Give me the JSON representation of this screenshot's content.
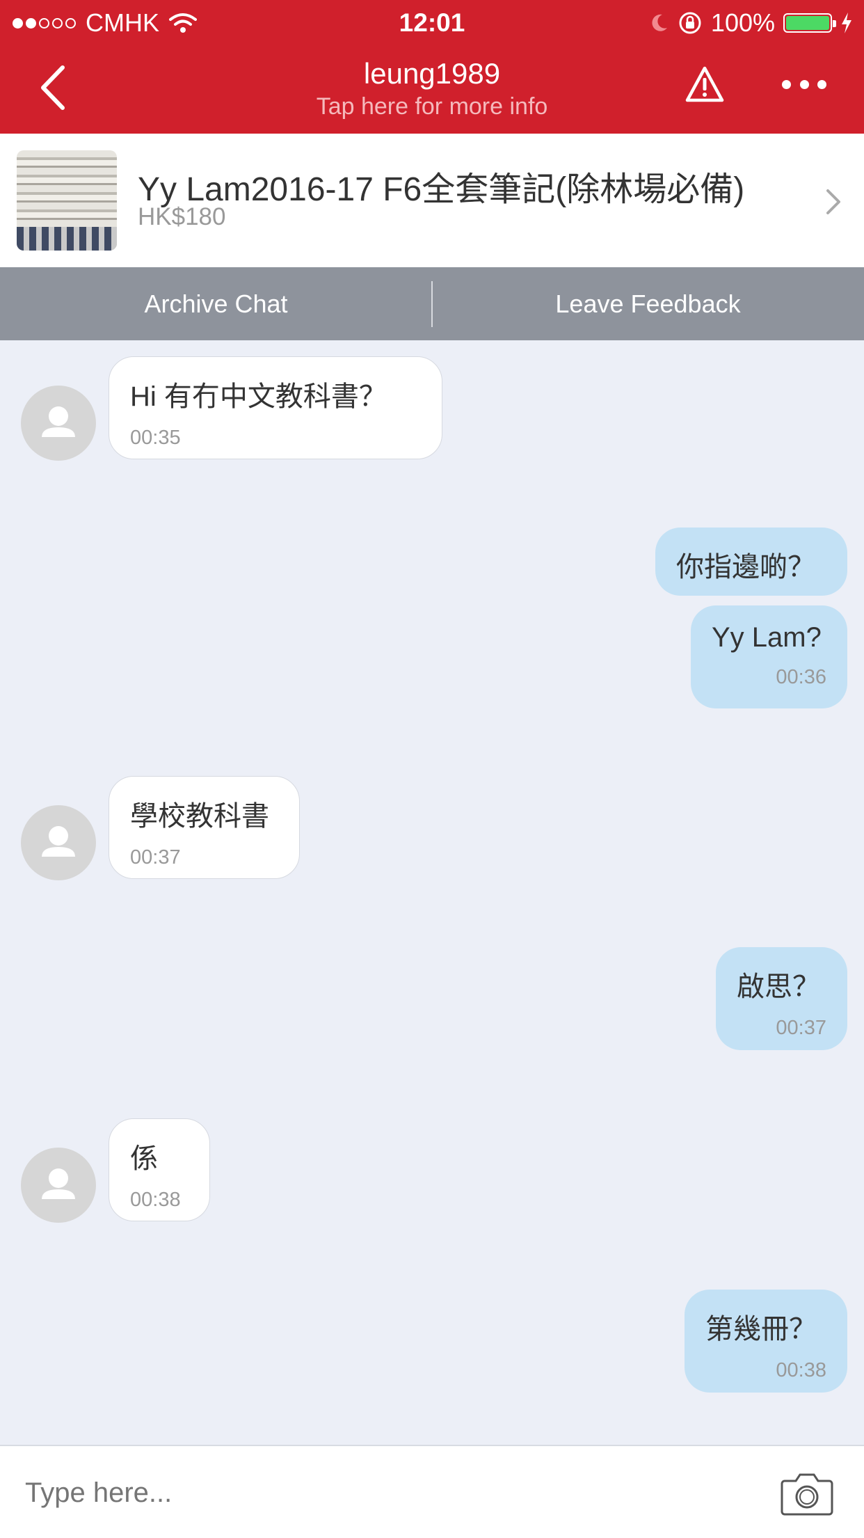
{
  "status_bar": {
    "carrier": "CMHK",
    "time": "12:01",
    "battery": "100%",
    "signal_bars_filled": 2,
    "signal_bars_total": 5,
    "battery_level": 1.0
  },
  "nav": {
    "title": "leung1989",
    "subtitle": "Tap here for more info",
    "icons": [
      "chevron-left-icon",
      "warning-icon",
      "more-icon"
    ]
  },
  "listing": {
    "title": "Yy Lam2016-17 F6全套筆記(除林場必備)",
    "price": "HK$180"
  },
  "actions": {
    "archive": "Archive Chat",
    "feedback": "Leave Feedback"
  },
  "messages": [
    {
      "side": "in",
      "text": "Hi 有冇中文教科書？",
      "time": "00:35"
    },
    {
      "side": "out",
      "text": "你指邊啲？",
      "time": ""
    },
    {
      "side": "out",
      "text": "Yy Lam?",
      "time": "00:36"
    },
    {
      "side": "in",
      "text": "學校教科書",
      "time": "00:37"
    },
    {
      "side": "out",
      "text": "啟思？",
      "time": "00:37"
    },
    {
      "side": "in",
      "text": "係",
      "time": "00:38"
    },
    {
      "side": "out",
      "text": "第幾冊？",
      "time": "00:38"
    }
  ],
  "composer": {
    "placeholder": "Type here..."
  },
  "colors": {
    "header": "#d0202c",
    "action_bar": "#8e939c",
    "background": "#eceff7",
    "outgoing_bubble": "#c3e1f5",
    "incoming_bubble": "#ffffff"
  }
}
